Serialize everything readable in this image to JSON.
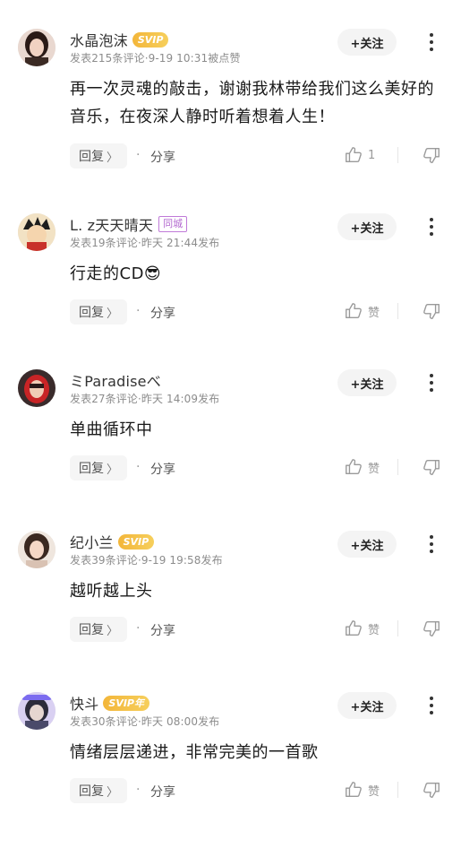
{
  "follow_label": "+关注",
  "reply_label": "回复",
  "reply_chevron": "〉",
  "dot": "·",
  "share_label": "分享",
  "comments": [
    {
      "username": "水晶泡沫",
      "badge": "SVIP",
      "meta": "发表215条评论·9-19 10:31被点赞",
      "content": "再一次灵魂的敲击，谢谢我林带给我们这么美好的音乐，在夜深人静时听着想着人生！",
      "likes": "1"
    },
    {
      "username": "L. z天天晴天",
      "badge": "同城",
      "meta": "发表19条评论·昨天 21:44发布",
      "content": "行走的CD😎",
      "likes": "赞"
    },
    {
      "username": "ミParadiseべ",
      "badge": "",
      "meta": "发表27条评论·昨天 14:09发布",
      "content": "单曲循环中",
      "likes": "赞"
    },
    {
      "username": "纪小兰",
      "badge": "SVIP",
      "meta": "发表39条评论·9-19 19:58发布",
      "content": "越听越上头",
      "likes": "赞"
    },
    {
      "username": "快斗",
      "badge": "SVIP年",
      "meta": "发表30条评论·昨天 08:00发布",
      "content": "情绪层层递进，非常完美的一首歌",
      "likes": "赞"
    }
  ],
  "colors": {
    "svip_gold": "#f3b63a",
    "city_badge": "#b36ad0",
    "meta_gray": "#8c8c8c",
    "button_bg": "#f4f4f4"
  }
}
